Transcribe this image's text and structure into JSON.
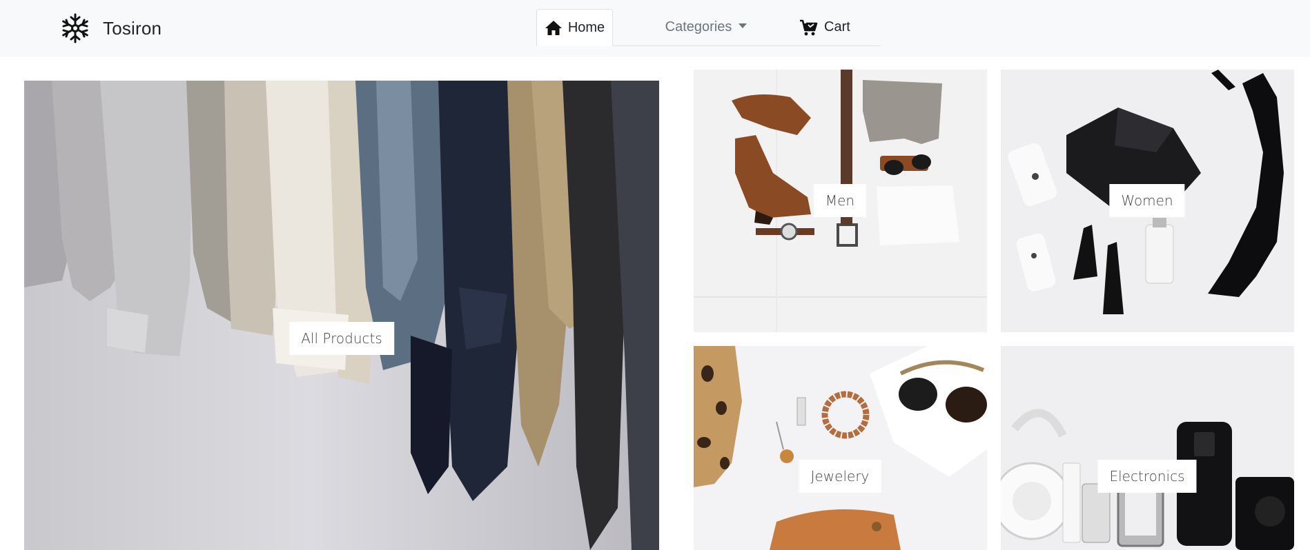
{
  "brand": {
    "name": "Tosiron",
    "logo_icon": "snowflake-icon"
  },
  "nav": {
    "home": {
      "label": "Home",
      "icon": "home-icon",
      "active": true
    },
    "categories": {
      "label": "Categories",
      "icon": "caret-down-icon"
    },
    "cart": {
      "label": "Cart",
      "icon": "cart-icon"
    }
  },
  "tiles": {
    "all": {
      "label": "All Products"
    },
    "men": {
      "label": "Men"
    },
    "women": {
      "label": "Women"
    },
    "jewelery": {
      "label": "Jewelery"
    },
    "electronics": {
      "label": "Electronics"
    }
  },
  "colors": {
    "navbar_bg": "#f8f9fa",
    "nav_inactive": "#6c757d",
    "text": "#212529"
  }
}
